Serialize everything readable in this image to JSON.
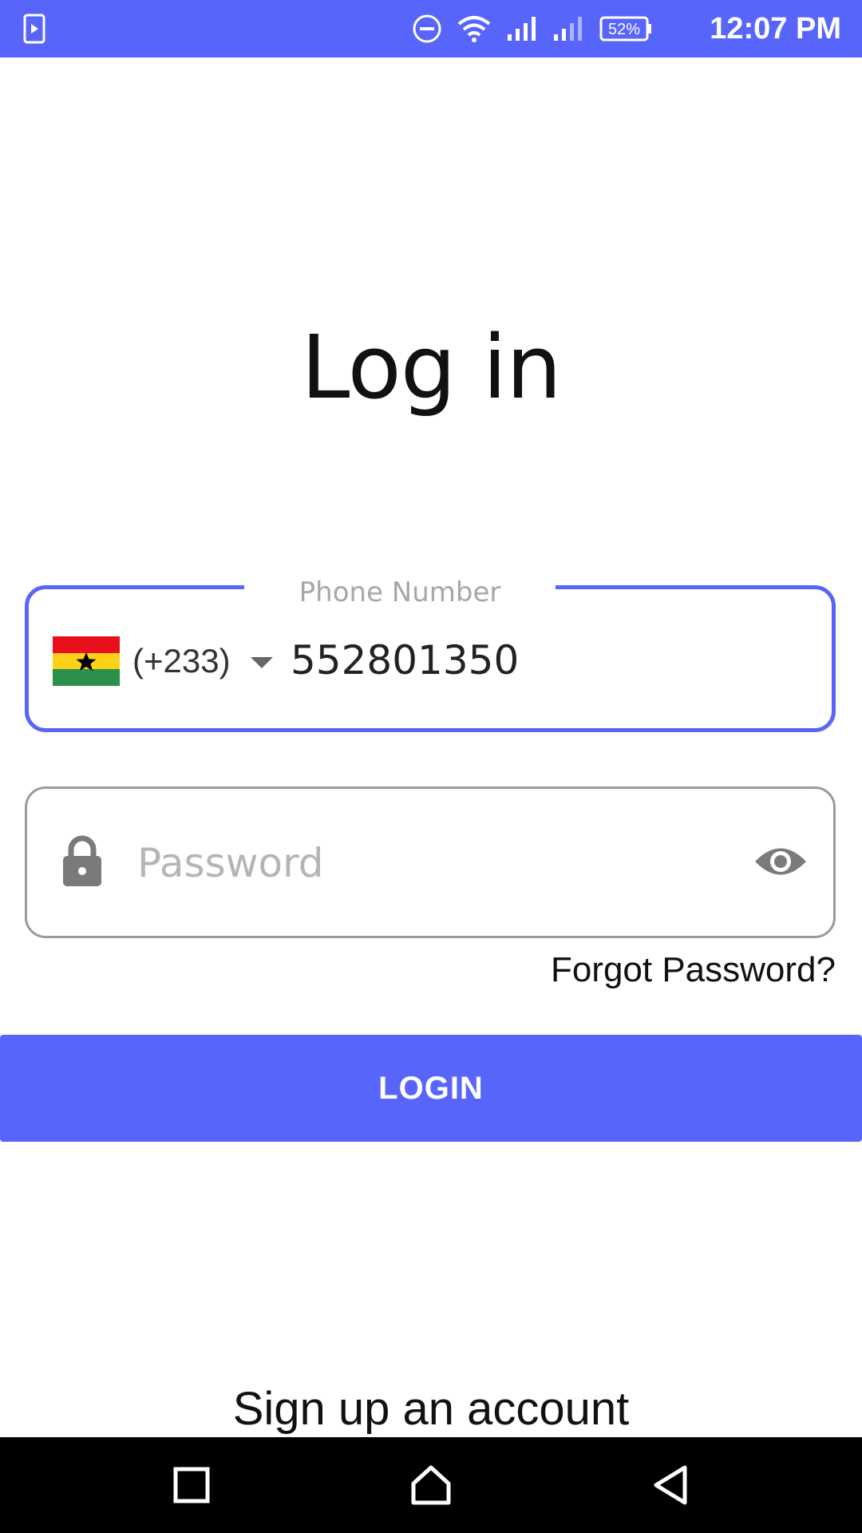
{
  "status_bar": {
    "time": "12:07 PM",
    "battery_percent": "52%",
    "icons": [
      "screen-record-icon",
      "do-not-disturb-icon",
      "wifi-icon",
      "signal-icon",
      "signal-icon",
      "battery-icon"
    ]
  },
  "login": {
    "title": "Log in",
    "phone": {
      "label": "Phone Number",
      "country_code": "(+233)",
      "country_flag": "ghana-flag-icon",
      "value": "552801350"
    },
    "password": {
      "placeholder": "Password",
      "value": ""
    },
    "forgot_password": "Forgot Password?",
    "login_button": "LOGIN",
    "signup_link": "Sign up an account"
  },
  "nav_bar": {
    "buttons": [
      "recents-icon",
      "home-icon",
      "back-icon"
    ]
  },
  "colors": {
    "accent": "#5865fa",
    "field_border": "#9a9a9a",
    "placeholder": "#b5b5b5"
  }
}
